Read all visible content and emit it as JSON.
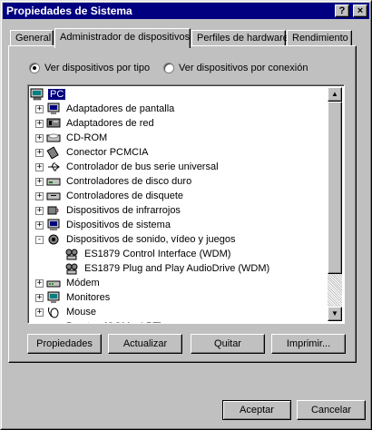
{
  "window": {
    "title": "Propiedades de Sistema",
    "help_label": "?",
    "close_label": "×"
  },
  "tabs": [
    {
      "label": "General"
    },
    {
      "label": "Administrador de dispositivos"
    },
    {
      "label": "Perfiles de hardware"
    },
    {
      "label": "Rendimiento"
    }
  ],
  "view_options": {
    "by_type": "Ver dispositivos por tipo",
    "by_connection": "Ver dispositivos por conexión",
    "selected": "by_type"
  },
  "tree": {
    "root": "PC",
    "items": [
      {
        "label": "Adaptadores de pantalla",
        "expander": "+",
        "icon": "display-adapter-icon"
      },
      {
        "label": "Adaptadores de red",
        "expander": "+",
        "icon": "network-adapter-icon"
      },
      {
        "label": "CD-ROM",
        "expander": "+",
        "icon": "cdrom-icon"
      },
      {
        "label": "Conector PCMCIA",
        "expander": "+",
        "icon": "pcmcia-icon"
      },
      {
        "label": "Controlador de bus serie universal",
        "expander": "+",
        "icon": "usb-icon"
      },
      {
        "label": "Controladores de disco duro",
        "expander": "+",
        "icon": "hard-disk-controller-icon"
      },
      {
        "label": "Controladores de disquete",
        "expander": "+",
        "icon": "floppy-controller-icon"
      },
      {
        "label": "Dispositivos de infrarrojos",
        "expander": "+",
        "icon": "infrared-icon"
      },
      {
        "label": "Dispositivos de sistema",
        "expander": "+",
        "icon": "system-device-icon"
      },
      {
        "label": "Dispositivos de sonido, vídeo y juegos",
        "expander": "-",
        "icon": "sound-video-icon"
      },
      {
        "label": "ES1879 Control Interface (WDM)",
        "child": true,
        "icon": "sound-device-icon"
      },
      {
        "label": "ES1879 Plug and Play AudioDrive (WDM)",
        "child": true,
        "icon": "sound-device-icon"
      },
      {
        "label": "Módem",
        "expander": "+",
        "icon": "modem-icon"
      },
      {
        "label": "Monitores",
        "expander": "+",
        "icon": "monitor-icon"
      },
      {
        "label": "Mouse",
        "expander": "+",
        "icon": "mouse-icon"
      },
      {
        "label": "Puertos (COM y LPT)",
        "expander": "+",
        "icon": "ports-icon"
      }
    ]
  },
  "action_buttons": {
    "properties": "Propiedades",
    "refresh": "Actualizar",
    "remove": "Quitar",
    "print": "Imprimir..."
  },
  "dialog_buttons": {
    "ok": "Aceptar",
    "cancel": "Cancelar"
  },
  "colors": {
    "titlebar": "#000080",
    "face": "#c0c0c0",
    "selection": "#000080"
  }
}
